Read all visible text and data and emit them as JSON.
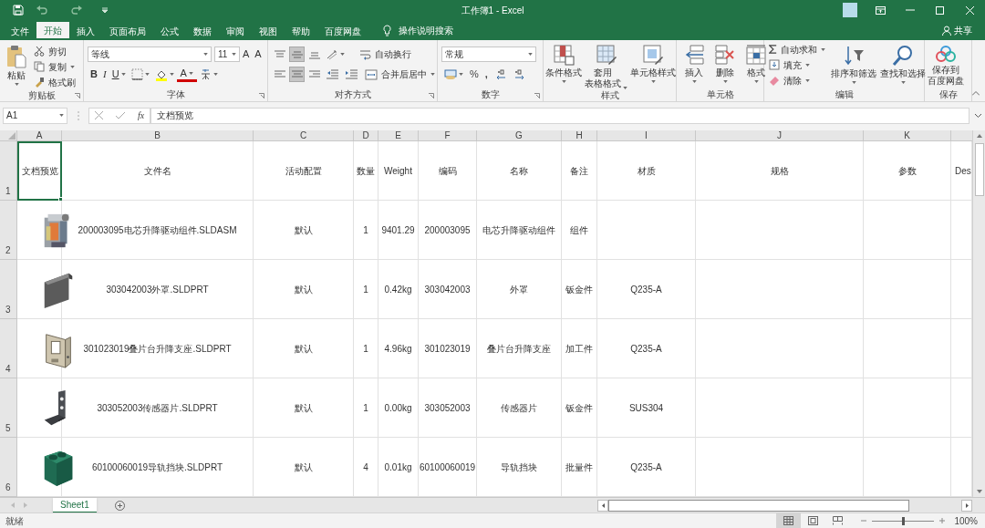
{
  "window": {
    "title": "工作簿1 - Excel"
  },
  "tabs": [
    {
      "label": "文件",
      "selected": false
    },
    {
      "label": "开始",
      "selected": true
    },
    {
      "label": "插入",
      "selected": false
    },
    {
      "label": "页面布局",
      "selected": false
    },
    {
      "label": "公式",
      "selected": false
    },
    {
      "label": "数据",
      "selected": false
    },
    {
      "label": "审阅",
      "selected": false
    },
    {
      "label": "视图",
      "selected": false
    },
    {
      "label": "帮助",
      "selected": false
    },
    {
      "label": "百度网盘",
      "selected": false
    }
  ],
  "tell_me": "操作说明搜索",
  "share": "共享",
  "ribbon": {
    "clipboard": {
      "label": "剪贴板",
      "paste": "粘贴",
      "cut": "剪切",
      "copy": "复制",
      "format_painter": "格式刷"
    },
    "font": {
      "label": "字体",
      "font_name": "等线",
      "font_size": "11",
      "grow": "A",
      "shrink": "A",
      "bold": "B",
      "italic": "I",
      "underline": "U",
      "font_color": "A"
    },
    "alignment": {
      "label": "对齐方式",
      "vertical": [
        {
          "selected": false
        },
        {
          "selected": true
        },
        {
          "selected": false
        }
      ],
      "horizontal": [
        {
          "selected": false
        },
        {
          "selected": true
        },
        {
          "selected": false
        }
      ],
      "wrap_text": "自动换行",
      "merge_center": "合并后居中"
    },
    "number": {
      "label": "数字",
      "format": "常规",
      "percent": "%",
      "comma": ","
    },
    "styles": {
      "label": "样式",
      "items": [
        {
          "lines": [
            "条件格式"
          ]
        },
        {
          "lines": [
            "套用",
            "表格格式"
          ]
        },
        {
          "lines": [
            "单元格样式"
          ]
        }
      ]
    },
    "cells": {
      "label": "单元格",
      "items": [
        "插入",
        "删除",
        "格式"
      ]
    },
    "editing": {
      "label": "编辑",
      "autosum": "自动求和",
      "fill": "填充",
      "clear": "清除",
      "sort_filter": "排序和筛选",
      "find_select": "查找和选择"
    },
    "save": {
      "label": "保存",
      "button": {
        "lines": [
          "保存到",
          "百度网盘"
        ]
      }
    }
  },
  "formula_bar": {
    "name_box": "A1",
    "fx": "fx",
    "value": "文档预览"
  },
  "sheet": {
    "columns": [
      "A",
      "B",
      "C",
      "D",
      "E",
      "F",
      "G",
      "H",
      "I",
      "J",
      "K"
    ],
    "header_row": {
      "number": "1",
      "cells": [
        {
          "text": "文档预览",
          "selected": true
        },
        {
          "text": "文件名",
          "selected": false
        },
        {
          "text": "活动配置",
          "selected": false
        },
        {
          "text": "数量",
          "selected": false
        },
        {
          "text": "Weight",
          "selected": false
        },
        {
          "text": "编码",
          "selected": false
        },
        {
          "text": "名称",
          "selected": false
        },
        {
          "text": "备注",
          "selected": false
        },
        {
          "text": "材质",
          "selected": false
        },
        {
          "text": "规格",
          "selected": false
        },
        {
          "text": "参数",
          "selected": false
        },
        {
          "text": "Des",
          "selected": false
        }
      ]
    },
    "rows": [
      {
        "number": "2",
        "file_name": "200003095电芯升降驱动组件.SLDASM",
        "configuration": "默认",
        "quantity": "1",
        "weight": "9401.29",
        "code": "200003095",
        "name": "电芯升降驱动组件",
        "note": "组件"
      },
      {
        "number": "3",
        "file_name": "303042003外罩.SLDPRT",
        "configuration": "默认",
        "quantity": "1",
        "weight": "0.42kg",
        "code": "303042003",
        "name": "外罩",
        "note": "钣金件",
        "material": "Q235-A"
      },
      {
        "number": "4",
        "file_name": "301023019叠片台升降支座.SLDPRT",
        "configuration": "默认",
        "quantity": "1",
        "weight": "4.96kg",
        "code": "301023019",
        "name": "叠片台升降支座",
        "note": "加工件",
        "material": "Q235-A"
      },
      {
        "number": "5",
        "file_name": "303052003传感器片.SLDPRT",
        "configuration": "默认",
        "quantity": "1",
        "weight": "0.00kg",
        "code": "303052003",
        "name": "传感器片",
        "note": "钣金件",
        "material": "SUS304"
      },
      {
        "number": "6",
        "file_name": "60100060019导轨挡块.SLDPRT",
        "configuration": "默认",
        "quantity": "4",
        "weight": "0.01kg",
        "code": "60100060019",
        "name": "导轨挡块",
        "note": "批量件",
        "material": "Q235-A"
      }
    ]
  },
  "sheet_tabs": [
    {
      "label": "Sheet1",
      "selected": true
    }
  ],
  "status_bar": {
    "status": "就绪",
    "views": [
      {
        "selected": true
      },
      {
        "selected": false
      },
      {
        "selected": false
      }
    ],
    "zoom": {
      "level": 0.5
    },
    "zoom_label": "100%"
  }
}
